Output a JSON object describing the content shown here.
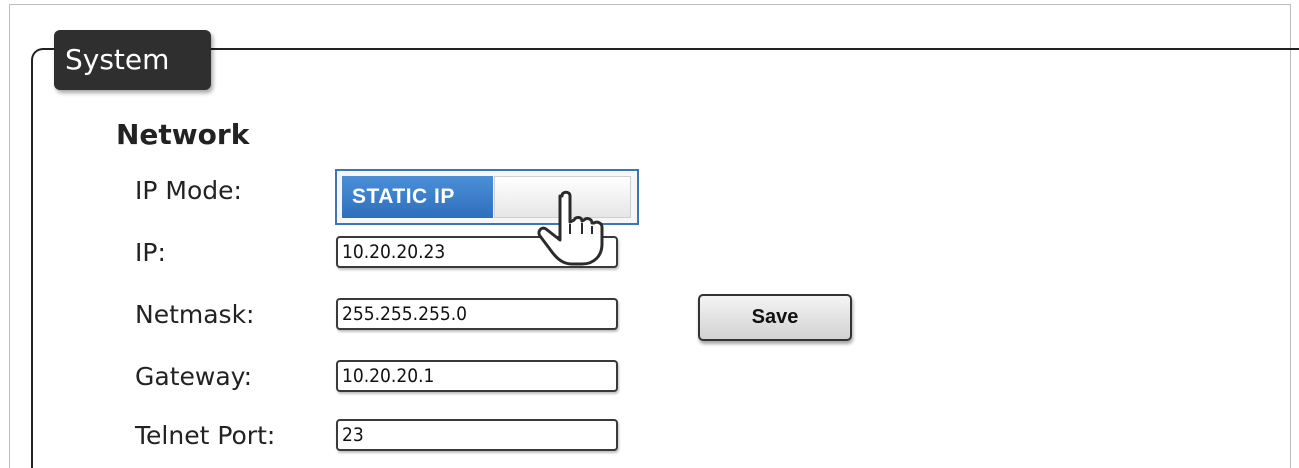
{
  "section": {
    "title": "System"
  },
  "network": {
    "heading": "Network",
    "ip_mode": {
      "label": "IP Mode:",
      "value": "STATIC IP"
    },
    "ip": {
      "label": "IP:",
      "value": "10.20.20.23"
    },
    "netmask": {
      "label": "Netmask:",
      "value": "255.255.255.0"
    },
    "gateway": {
      "label": "Gateway:",
      "value": "10.20.20.1"
    },
    "telnet_port": {
      "label": "Telnet Port:",
      "value": "23"
    },
    "save_label": "Save"
  },
  "colors": {
    "toggle_on": "#3a7cc9",
    "tab_background": "#2f2f2f"
  },
  "icons": {
    "cursor": "hand-pointer-icon"
  }
}
